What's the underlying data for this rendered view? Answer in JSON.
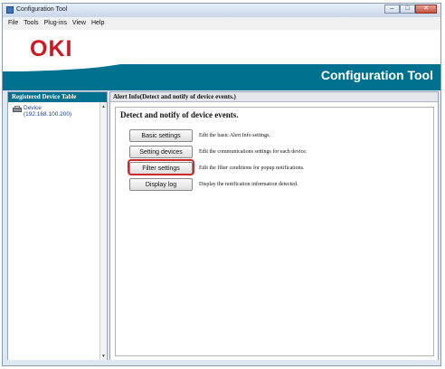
{
  "window": {
    "title": "Configuration Tool",
    "controls": {
      "minimize": "–",
      "maximize": "□",
      "close": "✕"
    }
  },
  "menu": [
    "File",
    "Tools",
    "Plug-ins",
    "View",
    "Help"
  ],
  "banner": {
    "logo": "OKI",
    "app_title": "Configuration Tool"
  },
  "sidebar": {
    "header": "Registered Device Table",
    "device_name": "Device",
    "device_ip": "(192.168.100.200)"
  },
  "main": {
    "header": "Alert Info(Detect and notify of device events.)",
    "section_title": "Detect and notify of device events.",
    "actions": [
      {
        "label": "Basic settings",
        "description": "Edit the basic Alert Info settings."
      },
      {
        "label": "Setting devices",
        "description": "Edit the communications settings for each device."
      },
      {
        "label": "Filter settings",
        "description": "Edit the filter conditions for popup notifications."
      },
      {
        "label": "Display log",
        "description": "Display the notification information detected."
      }
    ]
  },
  "colors": {
    "brand_red": "#d0171f",
    "teal": "#00728f",
    "highlight": "#cf2a2a"
  }
}
